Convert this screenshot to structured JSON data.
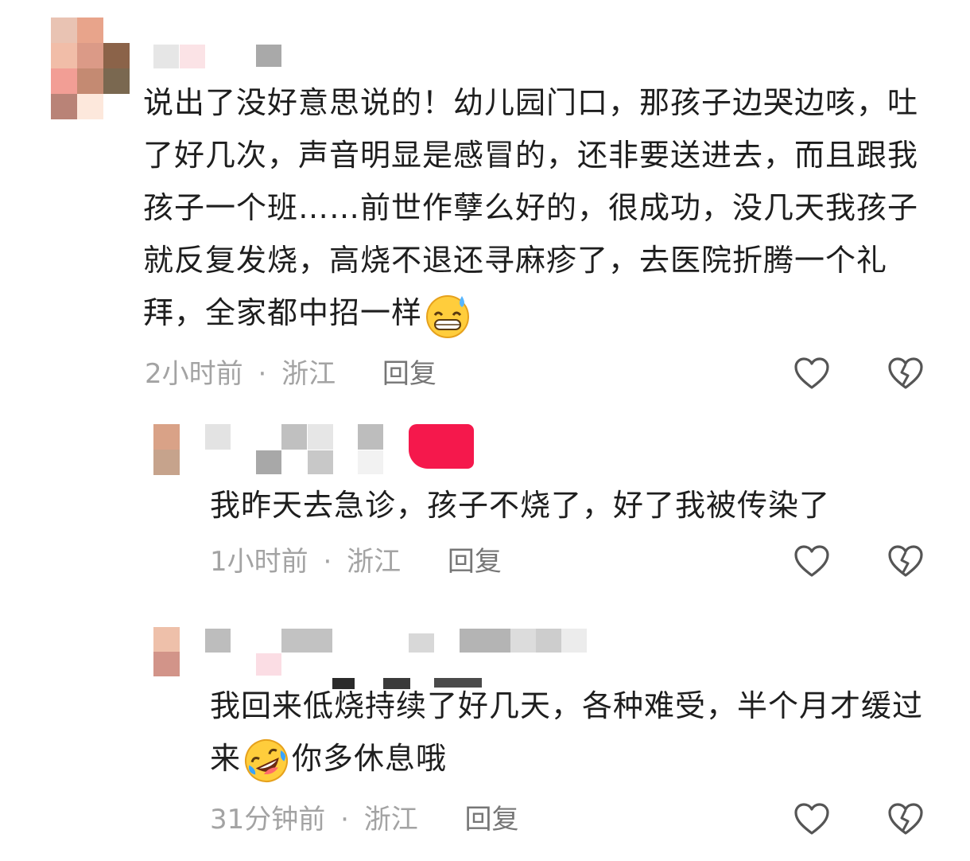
{
  "comments": [
    {
      "text_before": "说出了没好意思说的！幼儿园门口，那孩子边哭边咳，吐了好几次，声音明显是感冒的，还非要送进去，而且跟我孩子一个班……前世作孽么好的，很成功，没几天我孩子就反复发烧，高烧不退还寻麻疹了，去医院折腾一个礼拜，全家都中招一样",
      "emoji": "grin-sweat-icon",
      "text_after": "",
      "time": "2小时前",
      "location": "浙江",
      "reply_label": "回复"
    },
    {
      "text_before": "我昨天去急诊，孩子不烧了，好了我被传染了",
      "time": "1小时前",
      "location": "浙江",
      "reply_label": "回复"
    },
    {
      "text_before": "我回来低烧持续了好几天，各种难受，半个月才缓过来",
      "emoji": "rofl-icon",
      "text_after": "你多休息哦",
      "time": "31分钟前",
      "location": "浙江",
      "reply_label": "回复"
    }
  ],
  "separator": "·",
  "icons": [
    "heart-outline-icon",
    "broken-heart-outline-icon"
  ],
  "colors": {
    "text": "#1e1e1e",
    "meta": "#a3a3a3",
    "reply": "#767676",
    "badge": "#f5184c"
  }
}
